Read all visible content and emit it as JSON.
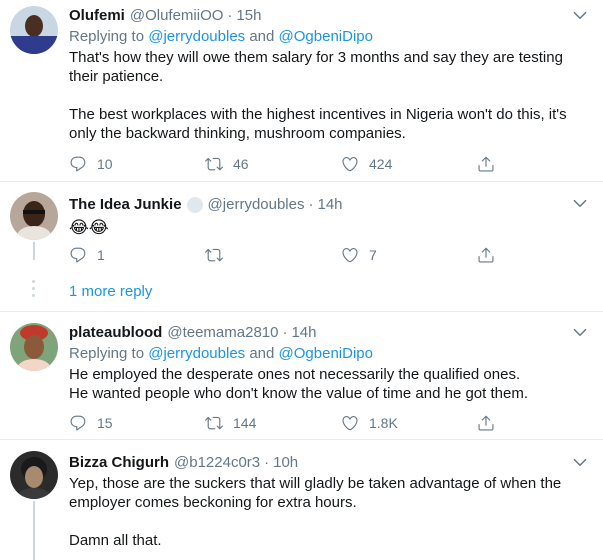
{
  "tweets": [
    {
      "name": "Olufemi",
      "handle": "@OlufemiiOO",
      "separator": "·",
      "time": "15h",
      "replying_prefix": "Replying to ",
      "replying_mention_1": "@jerrydoubles",
      "replying_and": " and ",
      "replying_mention_2": "@OgbeniDipo",
      "paragraphs": [
        "That's how they will owe them salary for 3 months and say they are testing their patience.",
        "The best workplaces with the highest incentives in Nigeria won't do this, it's only the backward thinking, mushroom companies."
      ],
      "replies": "10",
      "retweets": "46",
      "likes": "424"
    },
    {
      "name": "The Idea Junkie",
      "handle": "@jerrydoubles",
      "separator": "·",
      "time": "14h",
      "emoji": "😂😂",
      "replies": "1",
      "retweets": "",
      "likes": "7"
    },
    {
      "name": "plateaublood",
      "handle": "@teemama2810",
      "separator": "·",
      "time": "14h",
      "replying_prefix": "Replying to ",
      "replying_mention_1": "@jerrydoubles",
      "replying_and": " and ",
      "replying_mention_2": "@OgbeniDipo",
      "lines": [
        "He employed the desperate ones not necessarily the qualified ones.",
        "He wanted people who don't know the value of time and he got them."
      ],
      "replies": "15",
      "retweets": "144",
      "likes": "1.8K"
    },
    {
      "name": "Bizza Chigurh",
      "handle": "@b1224c0r3",
      "separator": "·",
      "time": "10h",
      "paragraphs": [
        "Yep, those are the suckers that will gladly be taken advantage of when the employer comes beckoning for extra hours.",
        "Damn all that."
      ]
    }
  ],
  "more_replies": "1 more reply",
  "colors": {
    "link": "#1b95e0",
    "secondary": "#657786",
    "border": "#e6ecf0"
  }
}
